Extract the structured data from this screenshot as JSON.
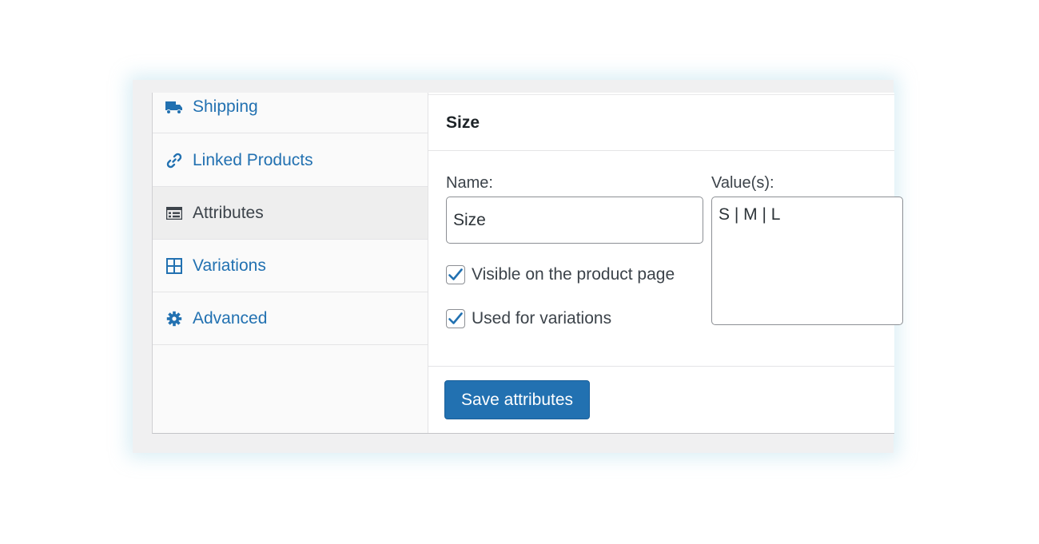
{
  "tabs": [
    {
      "label": "Shipping",
      "icon": "truck-icon",
      "active": false
    },
    {
      "label": "Linked Products",
      "icon": "link-icon",
      "active": false
    },
    {
      "label": "Attributes",
      "icon": "list-table-icon",
      "active": true
    },
    {
      "label": "Variations",
      "icon": "grid-icon",
      "active": false
    },
    {
      "label": "Advanced",
      "icon": "gear-icon",
      "active": false
    }
  ],
  "attribute": {
    "title": "Size",
    "name_label": "Name:",
    "name_value": "Size",
    "values_label": "Value(s):",
    "values_value": "S | M | L",
    "visible_label": "Visible on the product page",
    "visible_checked": true,
    "variations_label": "Used for variations",
    "variations_checked": true
  },
  "save_button": {
    "label": "Save attributes"
  },
  "colors": {
    "accent": "#2271b1",
    "text": "#3c434a",
    "active_tab_bg": "#eeeeee"
  }
}
